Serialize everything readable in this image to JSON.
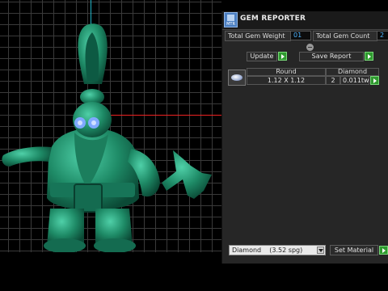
{
  "panel": {
    "title": "GEM REPORTER",
    "logo_label": "MTR",
    "total_weight_label": "Total Gem Weight",
    "total_weight_value": "01",
    "total_count_label": "Total Gem Count",
    "total_count_value": "2",
    "update_label": "Update",
    "save_report_label": "Save Report"
  },
  "table": {
    "headers": [
      "Round",
      "Diamond"
    ],
    "row": {
      "size": "1.12 X 1.12",
      "count": "2",
      "weight": "0.011tw"
    }
  },
  "footer": {
    "material_select": "Diamond    (3.52 spg)",
    "set_material_label": "Set Material"
  },
  "colors": {
    "value_text": "#4fb4ff",
    "model": "#1e8a66",
    "go_button": "#2f9a2f"
  }
}
